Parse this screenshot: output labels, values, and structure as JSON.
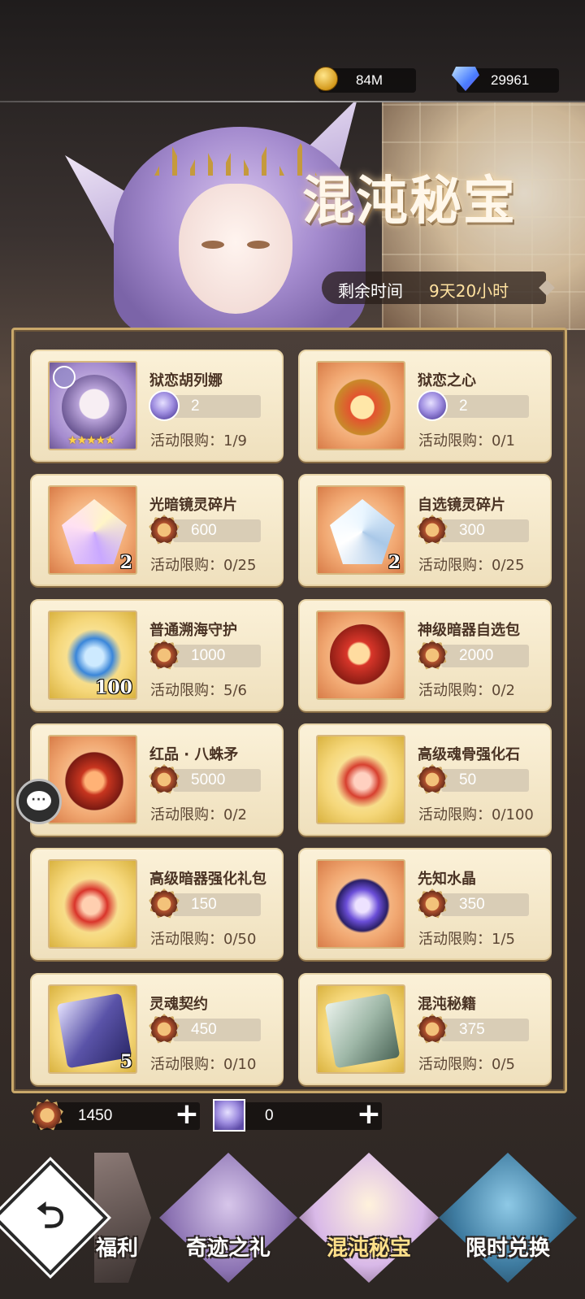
{
  "topbar": {
    "gold": "84M",
    "gems": "29961"
  },
  "banner": {
    "title": "混沌秘宝",
    "timer_label": "剩余时间",
    "timer_value": "9天20小时"
  },
  "shop_items": [
    {
      "name": "狱恋胡列娜",
      "price": "2",
      "currency": "soul",
      "limit": "活动限购：1/9",
      "qty": "",
      "stars": "★★★★★",
      "bg": "purple"
    },
    {
      "name": "狱恋之心",
      "price": "2",
      "currency": "soul",
      "limit": "活动限购：0/1",
      "qty": "",
      "stars": "",
      "bg": "orange"
    },
    {
      "name": "光暗镜灵碎片",
      "price": "600",
      "currency": "medal",
      "limit": "活动限购：0/25",
      "qty": "2",
      "stars": "",
      "bg": "orange"
    },
    {
      "name": "自选镜灵碎片",
      "price": "300",
      "currency": "medal",
      "limit": "活动限购：0/25",
      "qty": "2",
      "stars": "",
      "bg": "orange"
    },
    {
      "name": "普通溯海守护",
      "price": "1000",
      "currency": "medal",
      "limit": "活动限购：5/6",
      "qty": "100",
      "stars": "",
      "bg": "yellow"
    },
    {
      "name": "神级暗器自选包",
      "price": "2000",
      "currency": "medal",
      "limit": "活动限购：0/2",
      "qty": "",
      "stars": "",
      "bg": "orange"
    },
    {
      "name": "红品 · 八蛛矛",
      "price": "5000",
      "currency": "medal",
      "limit": "活动限购：0/2",
      "qty": "",
      "stars": "",
      "bg": "orange"
    },
    {
      "name": "高级魂骨强化石",
      "price": "50",
      "currency": "medal",
      "limit": "活动限购：0/100",
      "qty": "",
      "stars": "",
      "bg": "yellow"
    },
    {
      "name": "高级暗器强化礼包",
      "price": "150",
      "currency": "medal",
      "limit": "活动限购：0/50",
      "qty": "",
      "stars": "",
      "bg": "yellow"
    },
    {
      "name": "先知水晶",
      "price": "350",
      "currency": "medal",
      "limit": "活动限购：1/5",
      "qty": "",
      "stars": "",
      "bg": "orange"
    },
    {
      "name": "灵魂契约",
      "price": "450",
      "currency": "medal",
      "limit": "活动限购：0/10",
      "qty": "5",
      "stars": "",
      "bg": "yellow"
    },
    {
      "name": "混沌秘籍",
      "price": "375",
      "currency": "medal",
      "limit": "活动限购：0/5",
      "qty": "",
      "stars": "",
      "bg": "yellow"
    }
  ],
  "bottom_currency": {
    "medal": "1450",
    "soul": "0",
    "plus": "+"
  },
  "tabs": [
    {
      "label": "福利",
      "active": false
    },
    {
      "label": "奇迹之礼",
      "active": false
    },
    {
      "label": "混沌秘宝",
      "active": true
    },
    {
      "label": "限时兑换",
      "active": false
    }
  ],
  "back_glyph": "⮌",
  "chat_glyph": "···",
  "icons": {
    "gold": "gold-coin-icon",
    "gem": "diamond-icon",
    "medal": "medal-token-icon",
    "soul": "soul-orb-icon",
    "back": "back-arrow-icon",
    "chat": "chat-bubble-icon"
  },
  "colors": {
    "card_bg": "#fbf1d8",
    "panel_border": "#c9a86a",
    "active_tab": "#ffe08a"
  }
}
